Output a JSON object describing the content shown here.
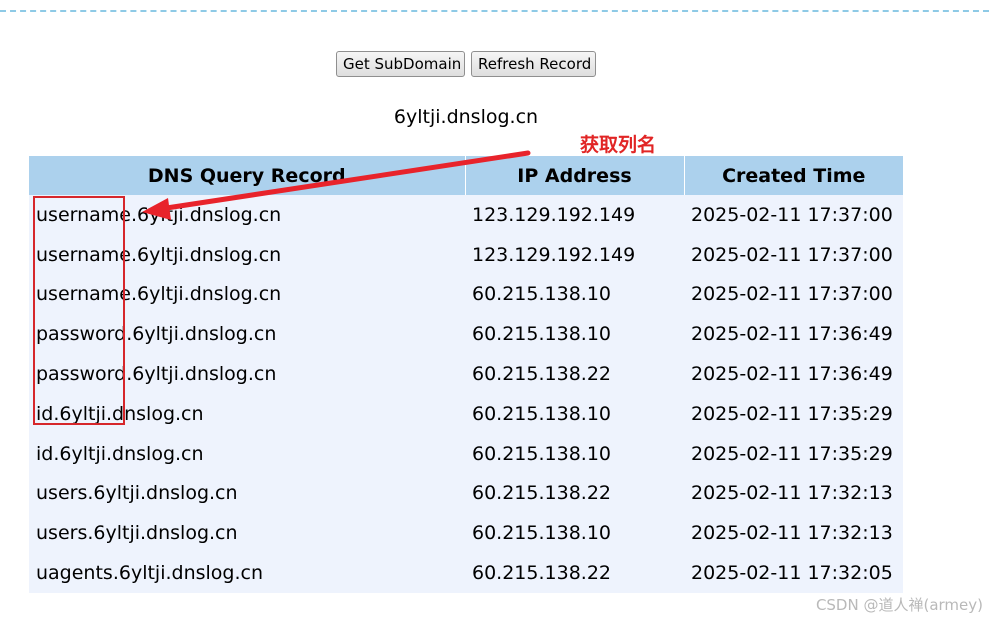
{
  "buttons": {
    "get_subdomain": "Get SubDomain",
    "refresh_record": "Refresh Record"
  },
  "domain": "6yltji.dnslog.cn",
  "annotation": {
    "note": "获取列名",
    "color": "#e12525"
  },
  "table": {
    "headers": [
      "DNS Query Record",
      "IP Address",
      "Created Time"
    ],
    "header_bg": "#acd1ed",
    "body_bg": "#eef3fd",
    "rows": [
      {
        "record": "username.6yltji.dnslog.cn",
        "ip": "123.129.192.149",
        "time": "2025-02-11 17:37:00"
      },
      {
        "record": "username.6yltji.dnslog.cn",
        "ip": "123.129.192.149",
        "time": "2025-02-11 17:37:00"
      },
      {
        "record": "username.6yltji.dnslog.cn",
        "ip": "60.215.138.10",
        "time": "2025-02-11 17:37:00"
      },
      {
        "record": "password.6yltji.dnslog.cn",
        "ip": "60.215.138.10",
        "time": "2025-02-11 17:36:49"
      },
      {
        "record": "password.6yltji.dnslog.cn",
        "ip": "60.215.138.22",
        "time": "2025-02-11 17:36:49"
      },
      {
        "record": "id.6yltji.dnslog.cn",
        "ip": "60.215.138.10",
        "time": "2025-02-11 17:35:29"
      },
      {
        "record": "id.6yltji.dnslog.cn",
        "ip": "60.215.138.10",
        "time": "2025-02-11 17:35:29"
      },
      {
        "record": "users.6yltji.dnslog.cn",
        "ip": "60.215.138.22",
        "time": "2025-02-11 17:32:13"
      },
      {
        "record": "users.6yltji.dnslog.cn",
        "ip": "60.215.138.10",
        "time": "2025-02-11 17:32:13"
      },
      {
        "record": "uagents.6yltji.dnslog.cn",
        "ip": "60.215.138.22",
        "time": "2025-02-11 17:32:05"
      }
    ]
  },
  "watermark": "CSDN @道人禅(armey)"
}
